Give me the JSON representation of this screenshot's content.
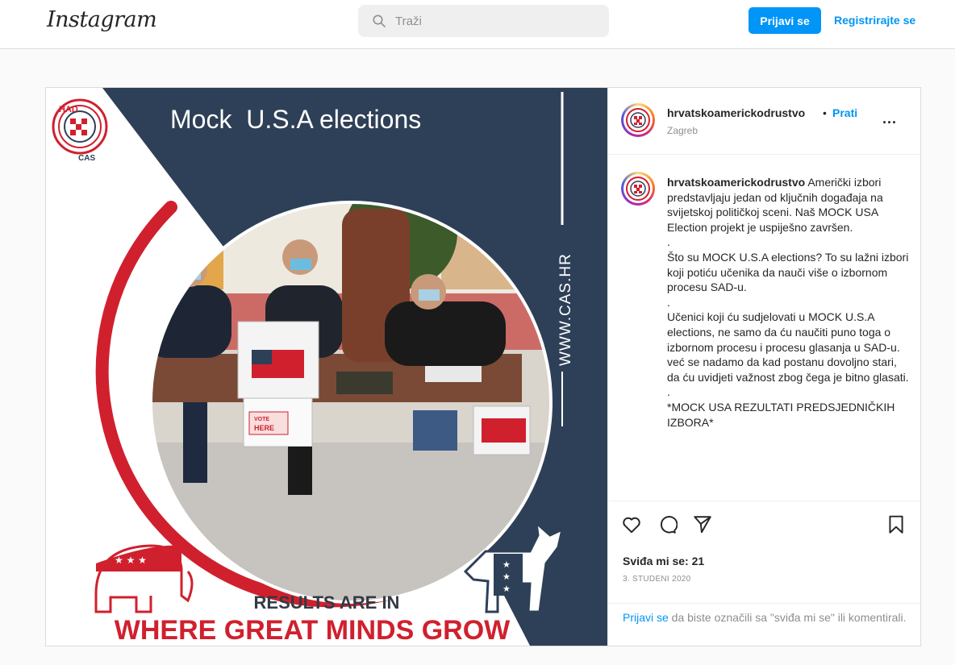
{
  "header": {
    "logo": "Instagram",
    "search_placeholder": "Traži",
    "login_label": "Prijavi se",
    "register_label": "Registrirajte se"
  },
  "post": {
    "username": "hrvatskoamerickodrustvo",
    "separator": "•",
    "follow_label": "Prati",
    "location": "Zagreb",
    "more_label": "...",
    "image": {
      "logo_text_top": "HAD",
      "logo_text_bottom": "CAS",
      "title": "Mock  U.S.A elections",
      "side_text": "WWW.CAS.HR",
      "ballot_label_line1": "VOTE",
      "ballot_label_line2": "HERE",
      "results_text": "RESULTS ARE IN",
      "slogan": "WHERE GREAT MINDS GROW",
      "stars": "★ ★ ★",
      "colors": {
        "navy": "#2e4057",
        "red": "#d0202e",
        "white": "#ffffff"
      }
    },
    "caption": {
      "lines": [
        "Američki izbori predstavljaju jedan od ključnih događaja na svijetskoj političkoj sceni. Naš MOCK USA Election projekt je uspiješno završen.",
        ".",
        "Što su MOCK U.S.A elections? To su lažni izbori koji potiću učenika da nauči više o izbornom procesu SAD-u.",
        ".",
        "Učenici koji ću sudjelovati u MOCK U.S.A elections, ne samo da ću naučiti puno toga o izbornom procesu i procesu glasanja u SAD-u. već se nadamo da kad postanu dovoljno stari, da ću uvidjeti važnost zbog čega je bitno glasati.",
        ".",
        "*MOCK USA REZULTATI PREDSJEDNIČKIH IZBORA*"
      ]
    },
    "icons": [
      "heart-icon",
      "comment-icon",
      "share-icon",
      "bookmark-icon"
    ],
    "likes": "Sviđa mi se: 21",
    "date": "3. STUDENI 2020",
    "login_link": "Prijavi se",
    "login_note": " da biste označili sa \"sviđa mi se\" ili komentirali."
  }
}
